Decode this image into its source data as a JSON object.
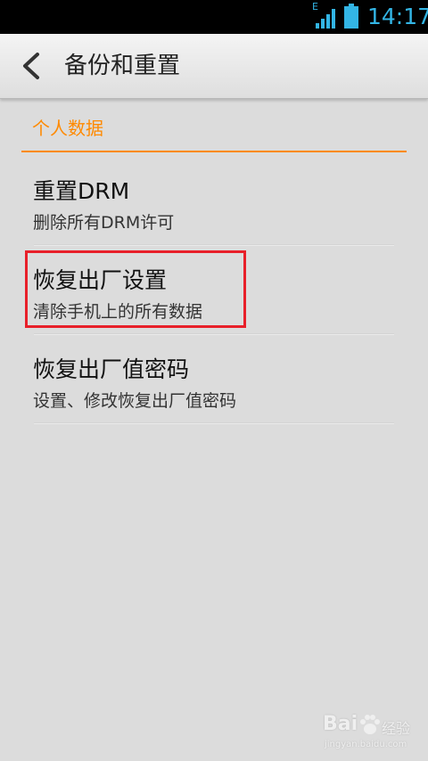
{
  "status_bar": {
    "network": "E",
    "time": "14:17",
    "icons": [
      "signal-icon",
      "battery-icon"
    ]
  },
  "action_bar": {
    "title": "备份和重置",
    "back_icon": "chevron-left-icon"
  },
  "section": {
    "header": "个人数据"
  },
  "items": [
    {
      "title": "重置DRM",
      "subtitle": "删除所有DRM许可"
    },
    {
      "title": "恢复出厂设置",
      "subtitle": "清除手机上的所有数据"
    },
    {
      "title": "恢复出厂值密码",
      "subtitle": "设置、修改恢复出厂值密码"
    }
  ],
  "watermark": {
    "brand": "Bai",
    "brand_suffix": "经验",
    "url": "jingyan.baidu.com"
  },
  "colors": {
    "accent": "#ff8a00",
    "status_icon": "#33b5e5",
    "highlight": "#e8202a",
    "background": "#dcdcdc"
  }
}
